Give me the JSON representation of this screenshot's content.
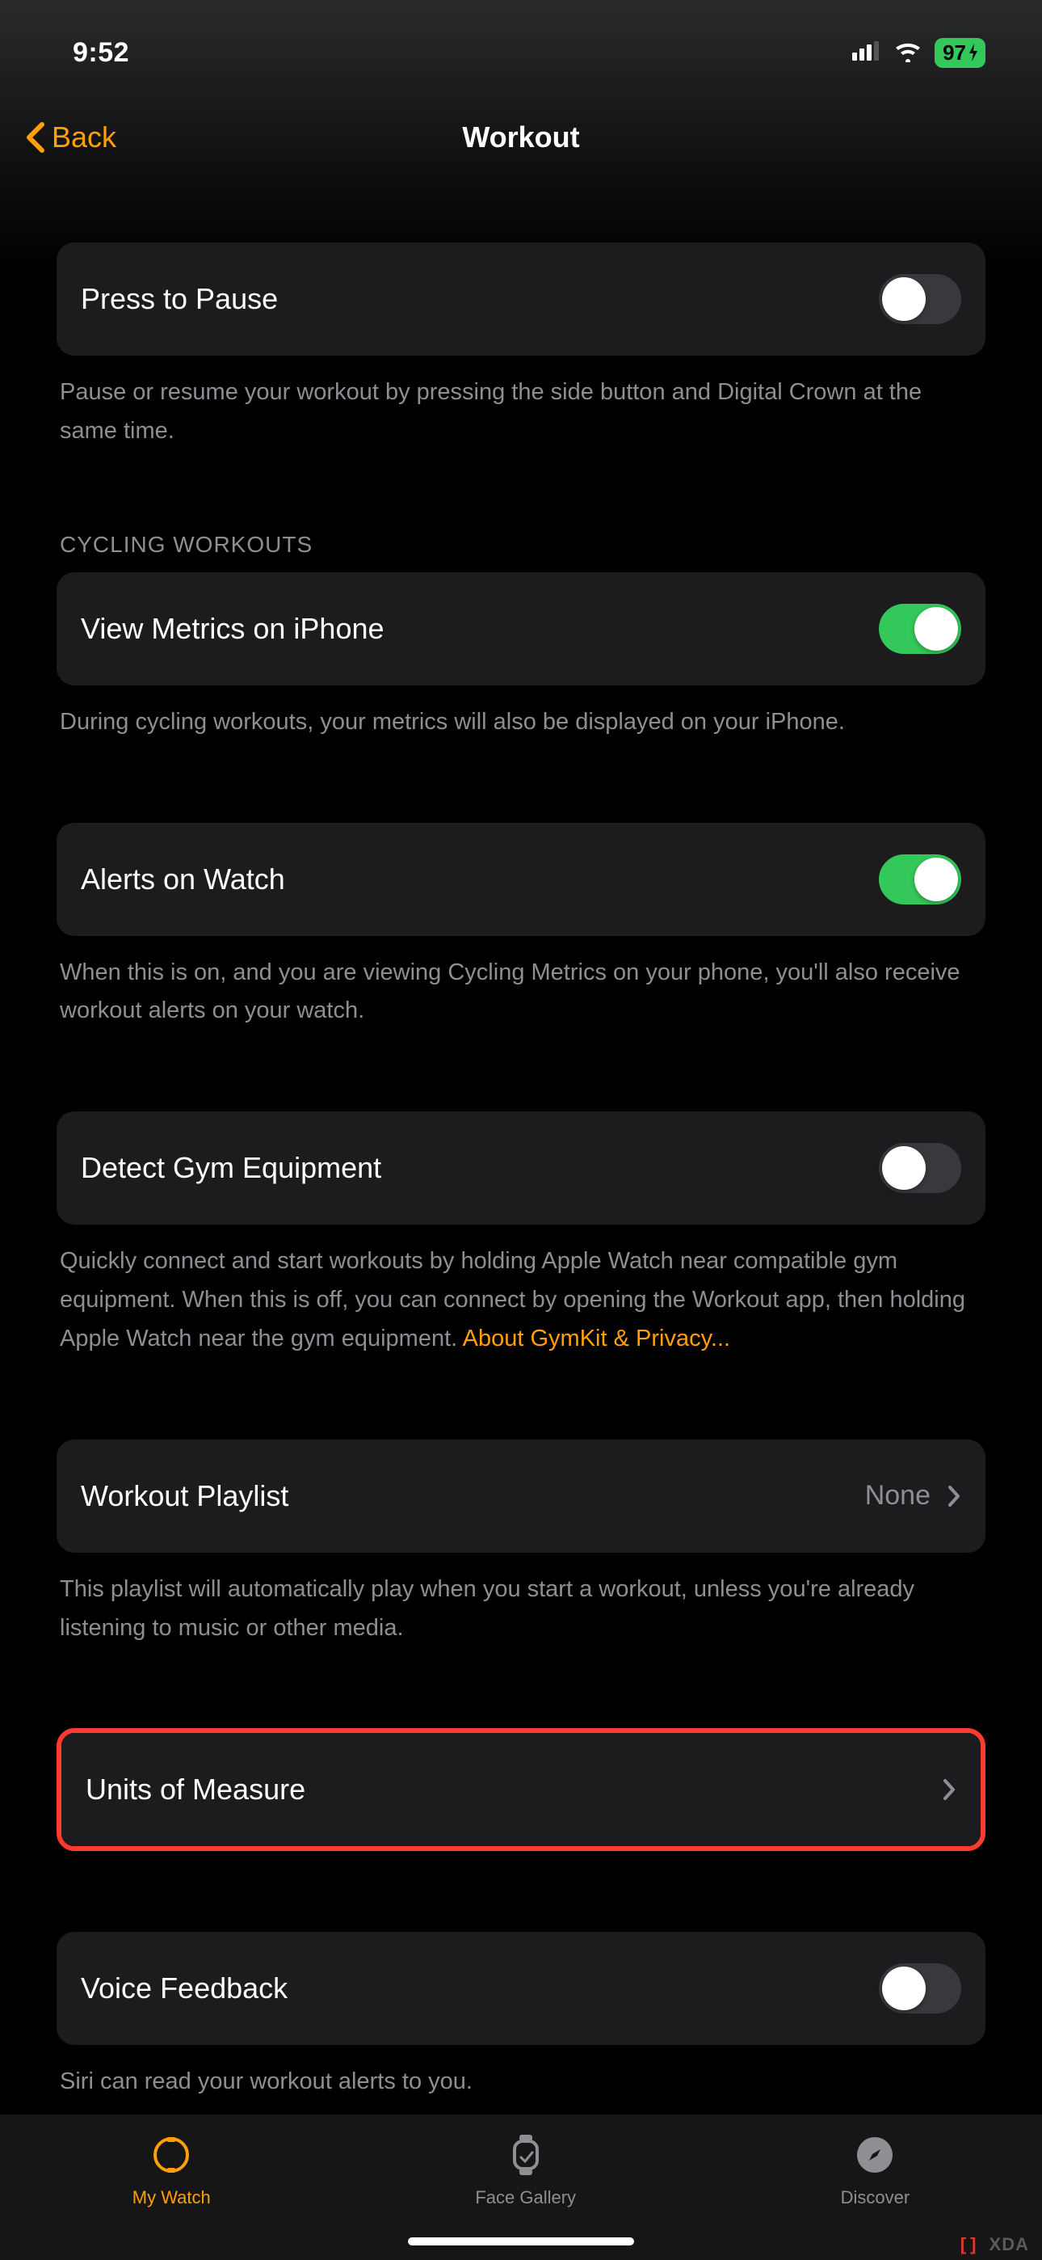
{
  "status": {
    "time": "9:52",
    "battery_percent": "97"
  },
  "nav": {
    "back_label": "Back",
    "title": "Workout"
  },
  "sections": {
    "press_to_pause": {
      "label": "Press to Pause",
      "on": false,
      "footer": "Pause or resume your workout by pressing the side button and Digital Crown at the same time."
    },
    "cycling_header": "CYCLING WORKOUTS",
    "view_metrics": {
      "label": "View Metrics on iPhone",
      "on": true,
      "footer": "During cycling workouts, your metrics will also be displayed on your iPhone."
    },
    "alerts_on_watch": {
      "label": "Alerts on Watch",
      "on": true,
      "footer": "When this is on, and you are viewing Cycling Metrics on your phone, you'll also receive workout alerts on your watch."
    },
    "detect_gym": {
      "label": "Detect Gym Equipment",
      "on": false,
      "footer": "Quickly connect and start workouts by holding Apple Watch near compatible gym equipment. When this is off, you can connect by opening the Workout app, then holding Apple Watch near the gym equipment. ",
      "footer_link": "About GymKit & Privacy..."
    },
    "workout_playlist": {
      "label": "Workout Playlist",
      "value": "None",
      "footer": "This playlist will automatically play when you start a workout, unless you're already listening to music or other media."
    },
    "units_of_measure": {
      "label": "Units of Measure"
    },
    "voice_feedback": {
      "label": "Voice Feedback",
      "on": false,
      "footer": "Siri can read your workout alerts to you."
    }
  },
  "tabs": {
    "my_watch": "My Watch",
    "face_gallery": "Face Gallery",
    "discover": "Discover"
  },
  "watermark": "XDA"
}
